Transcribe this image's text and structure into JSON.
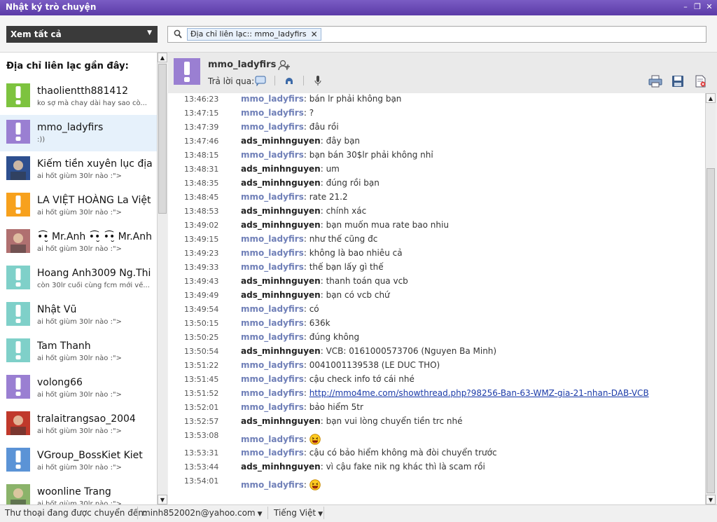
{
  "window": {
    "title": "Nhật ký trò chuyện"
  },
  "toolbar": {
    "view_select": "Xem tất cả",
    "search_chip": "Địa chỉ liên lạc:: mmo_ladyfirs",
    "chip_close": "✕"
  },
  "sidebar": {
    "heading": "Địa chỉ liên lạc gần đây:",
    "contacts": [
      {
        "name": "thaolientth881412",
        "status": "ko sợ mà chay dài hay sao cò...",
        "avatar_color": "#7dc33f",
        "avatar_type": "exclaim"
      },
      {
        "name": "mmo_ladyfirs",
        "status": ":))",
        "avatar_color": "#9a7fd2",
        "avatar_type": "exclaim"
      },
      {
        "name": "Kiếm tiền xuyên lục địa",
        "status": "ai hốt giùm 30lr nào :\">",
        "avatar_color": "#2d4f8f",
        "avatar_type": "photo"
      },
      {
        "name": "LA VIỆT HOÀNG La Việt",
        "status": "ai hốt giùm 30lr nào :\">",
        "avatar_color": "#f7a11d",
        "avatar_type": "exclaim"
      },
      {
        "name": "•͡•̮ Mr.Anh •͡•̮ •͡•̮ Mr.Anh",
        "status": "ai hốt giùm 30lr nào :\">",
        "avatar_color": "#b07070",
        "avatar_type": "photo"
      },
      {
        "name": "Hoang Anh3009 Ng.Thi",
        "status": "còn 30lr cuối cùng fcm mới về...",
        "avatar_color": "#7fd0c9",
        "avatar_type": "exclaim"
      },
      {
        "name": "Nhật Vũ",
        "status": "ai hốt giùm 30lr nào :\">",
        "avatar_color": "#7fd0c9",
        "avatar_type": "exclaim"
      },
      {
        "name": "Tam Thanh",
        "status": "ai hốt giùm 30lr nào :\">",
        "avatar_color": "#7fd0c9",
        "avatar_type": "exclaim"
      },
      {
        "name": "volong66",
        "status": "ai hốt giùm 30lr nào :\">",
        "avatar_color": "#9a7fd2",
        "avatar_type": "exclaim"
      },
      {
        "name": "tralaitrangsao_2004",
        "status": "ai hốt giùm 30lr nào :\">",
        "avatar_color": "#c0392b",
        "avatar_type": "photo"
      },
      {
        "name": "VGroup_BossKiet Kiet",
        "status": "ai hốt giùm 30lr nào :\">",
        "avatar_color": "#5b93d6",
        "avatar_type": "exclaim"
      },
      {
        "name": "woonline Trang",
        "status": "ai hốt giùm 30lr nào :\">",
        "avatar_color": "#8bb36a",
        "avatar_type": "photo"
      }
    ]
  },
  "chat_header": {
    "name": "mmo_ladyfirs",
    "reply_label": "Trả lời qua:"
  },
  "messages": [
    {
      "time": "13:46:23",
      "sender": "mmo_ladyfirs",
      "who": "them",
      "text": "bán lr phải không bạn"
    },
    {
      "time": "13:47:15",
      "sender": "mmo_ladyfirs",
      "who": "them",
      "text": "?"
    },
    {
      "time": "13:47:39",
      "sender": "mmo_ladyfirs",
      "who": "them",
      "text": "đâu rồi"
    },
    {
      "time": "13:47:46",
      "sender": "ads_minhnguyen",
      "who": "me",
      "text": "đây bạn"
    },
    {
      "time": "13:48:15",
      "sender": "mmo_ladyfirs",
      "who": "them",
      "text": "bạn bán 30$lr phải không nhỉ"
    },
    {
      "time": "13:48:31",
      "sender": "ads_minhnguyen",
      "who": "me",
      "text": "um"
    },
    {
      "time": "13:48:35",
      "sender": "ads_minhnguyen",
      "who": "me",
      "text": "đúng rồi bạn"
    },
    {
      "time": "13:48:45",
      "sender": "mmo_ladyfirs",
      "who": "them",
      "text": "rate 21.2"
    },
    {
      "time": "13:48:53",
      "sender": "ads_minhnguyen",
      "who": "me",
      "text": "chính xác"
    },
    {
      "time": "13:49:02",
      "sender": "ads_minhnguyen",
      "who": "me",
      "text": "bạn muốn mua rate bao nhiu"
    },
    {
      "time": "13:49:15",
      "sender": "mmo_ladyfirs",
      "who": "them",
      "text": "như thế cũng đc"
    },
    {
      "time": "13:49:23",
      "sender": "mmo_ladyfirs",
      "who": "them",
      "text": "không là bao nhiêu cả"
    },
    {
      "time": "13:49:33",
      "sender": "mmo_ladyfirs",
      "who": "them",
      "text": "thế bạn lấy gì thế"
    },
    {
      "time": "13:49:43",
      "sender": "ads_minhnguyen",
      "who": "me",
      "text": "thanh toán qua vcb"
    },
    {
      "time": "13:49:49",
      "sender": "ads_minhnguyen",
      "who": "me",
      "text": "bạn có vcb chứ"
    },
    {
      "time": "13:49:54",
      "sender": "mmo_ladyfirs",
      "who": "them",
      "text": "có"
    },
    {
      "time": "13:50:15",
      "sender": "mmo_ladyfirs",
      "who": "them",
      "text": "636k"
    },
    {
      "time": "13:50:25",
      "sender": "mmo_ladyfirs",
      "who": "them",
      "text": "đúng không"
    },
    {
      "time": "13:50:54",
      "sender": "ads_minhnguyen",
      "who": "me",
      "text": "VCB: 0161000573706 (Nguyen Ba Minh)"
    },
    {
      "time": "13:51:22",
      "sender": "mmo_ladyfirs",
      "who": "them",
      "text": "0041001139538 (LE DUC THO)"
    },
    {
      "time": "13:51:45",
      "sender": "mmo_ladyfirs",
      "who": "them",
      "text": "cậu check info tớ cái nhé"
    },
    {
      "time": "13:51:52",
      "sender": "mmo_ladyfirs",
      "who": "them",
      "link": "http://mmo4me.com/showthread.php?98256-Ban-63-WMZ-gia-21-nhan-DAB-VCB"
    },
    {
      "time": "13:52:01",
      "sender": "mmo_ladyfirs",
      "who": "them",
      "text": "bảo hiểm 5tr"
    },
    {
      "time": "13:52:57",
      "sender": "ads_minhnguyen",
      "who": "me",
      "text": "bạn vui lòng chuyển tiền trc nhé"
    },
    {
      "time": "13:53:08",
      "sender": "mmo_ladyfirs",
      "who": "them",
      "smiley": "laughing-smiley",
      "tall": true
    },
    {
      "time": "13:53:31",
      "sender": "mmo_ladyfirs",
      "who": "them",
      "text": "cậu có bảo hiểm không mà đòi chuyển trước"
    },
    {
      "time": "13:53:44",
      "sender": "ads_minhnguyen",
      "who": "me",
      "text": "vì cậu fake nik ng khác thì là scam rồi"
    },
    {
      "time": "13:54:01",
      "sender": "mmo_ladyfirs",
      "who": "them",
      "smiley": "laughing-smiley",
      "tall": true
    }
  ],
  "statusbar": {
    "forward_label": "Thư thoại đang được chuyển đến:",
    "email": "minh852002n@yahoo.com",
    "language": "Tiếng Việt"
  }
}
